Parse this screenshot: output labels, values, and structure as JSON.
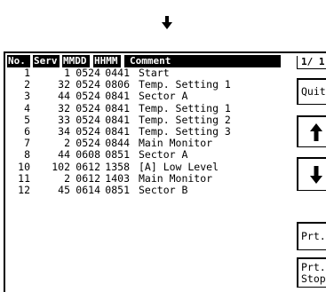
{
  "header": {
    "no": "No.",
    "serv": "Serv",
    "mmdd": "MMDD",
    "hhmm": "HHMM",
    "comment": "Comment",
    "page": "1/ 1"
  },
  "rows": [
    {
      "no": "1",
      "serv": "1",
      "mmdd": "0524",
      "hhmm": "0441",
      "comment": "Start"
    },
    {
      "no": "2",
      "serv": "32",
      "mmdd": "0524",
      "hhmm": "0806",
      "comment": "Temp. Setting 1"
    },
    {
      "no": "3",
      "serv": "44",
      "mmdd": "0524",
      "hhmm": "0841",
      "comment": "Sector A"
    },
    {
      "no": "4",
      "serv": "32",
      "mmdd": "0524",
      "hhmm": "0841",
      "comment": "Temp. Setting 1"
    },
    {
      "no": "5",
      "serv": "33",
      "mmdd": "0524",
      "hhmm": "0841",
      "comment": "Temp. Setting 2"
    },
    {
      "no": "6",
      "serv": "34",
      "mmdd": "0524",
      "hhmm": "0841",
      "comment": "Temp. Setting 3"
    },
    {
      "no": "7",
      "serv": "2",
      "mmdd": "0524",
      "hhmm": "0844",
      "comment": "Main Monitor"
    },
    {
      "no": "8",
      "serv": "44",
      "mmdd": "0608",
      "hhmm": "0851",
      "comment": "Sector A"
    },
    {
      "no": "10",
      "serv": "102",
      "mmdd": "0612",
      "hhmm": "1358",
      "comment": "[A] Low Level"
    },
    {
      "no": "11",
      "serv": "2",
      "mmdd": "0612",
      "hhmm": "1403",
      "comment": "Main Monitor"
    },
    {
      "no": "12",
      "serv": "45",
      "mmdd": "0614",
      "hhmm": "0851",
      "comment": "Sector B"
    }
  ],
  "buttons": {
    "quit": "Quit",
    "up": "up-arrow-icon",
    "down": "down-arrow-icon",
    "prt": "Prt.",
    "prt_stop_line1": "Prt.",
    "prt_stop_line2": "Stop"
  }
}
